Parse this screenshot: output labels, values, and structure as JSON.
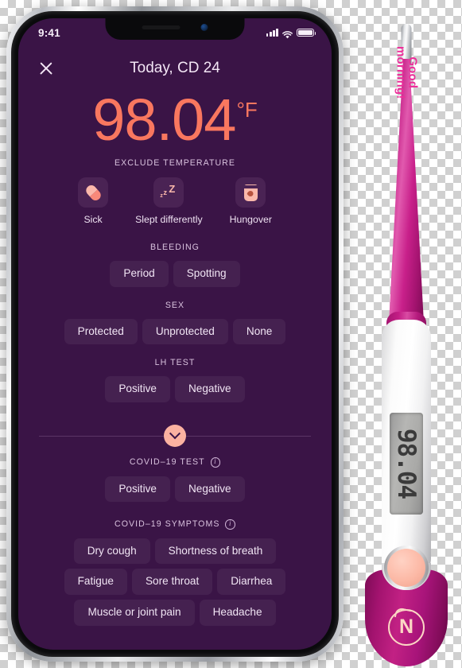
{
  "phone": {
    "status_bar": {
      "time": "9:41",
      "signal_icon": "cellular-bars-icon",
      "wifi_icon": "wifi-icon",
      "battery_icon": "battery-full-icon"
    },
    "header": {
      "close_icon": "close-icon",
      "title": "Today, CD 24"
    },
    "temperature": {
      "value": "98.04",
      "unit": "°F",
      "color": "#f9775f"
    },
    "exclude_temperature": {
      "title": "EXCLUDE TEMPERATURE",
      "items": [
        {
          "label": "Sick",
          "icon": "pill-icon"
        },
        {
          "label": "Slept differently",
          "icon": "sleep-zzz-icon"
        },
        {
          "label": "Hungover",
          "icon": "drink-cup-icon"
        }
      ]
    },
    "bleeding": {
      "title": "BLEEDING",
      "options": [
        "Period",
        "Spotting"
      ]
    },
    "sex": {
      "title": "SEX",
      "options": [
        "Protected",
        "Unprotected",
        "None"
      ]
    },
    "lh_test": {
      "title": "LH TEST",
      "options": [
        "Positive",
        "Negative"
      ]
    },
    "expander": {
      "icon": "chevron-down-icon"
    },
    "covid_test": {
      "title": "COVID–19 TEST",
      "info_icon": "info-icon",
      "options": [
        "Positive",
        "Negative"
      ]
    },
    "covid_symptoms": {
      "title": "COVID–19 SYMPTOMS",
      "info_icon": "info-icon",
      "rows": [
        [
          "Dry cough",
          "Shortness of breath"
        ],
        [
          "Fatigue",
          "Sore throat",
          "Diarrhea"
        ],
        [
          "Muscle or joint pain",
          "Headache"
        ]
      ]
    },
    "theme": {
      "background": "#3a1446",
      "chip_background": "#452150",
      "accent": "#f9775f",
      "text": "#f1e5f4"
    }
  },
  "thermometer": {
    "greeting": "Good\nmorning!",
    "greeting_color": "#ec2f9a",
    "display_value": "98.04",
    "button_icon": "power-button",
    "logo_letter": "N",
    "body_color": "#c41e86"
  }
}
